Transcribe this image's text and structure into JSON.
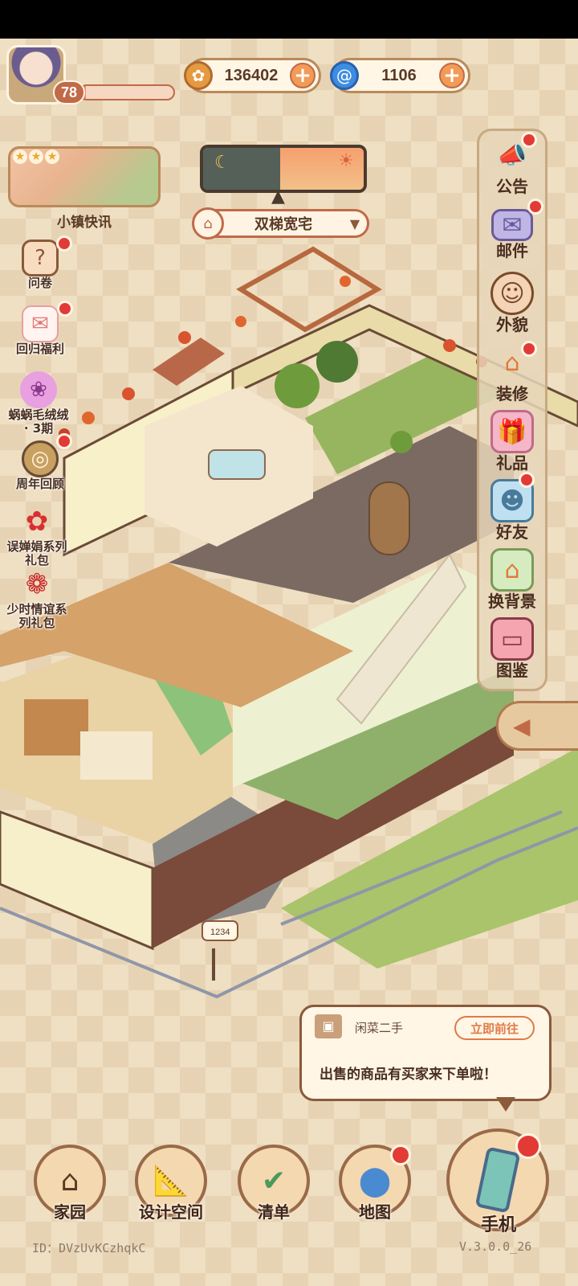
{
  "player": {
    "level": "78",
    "exp_fraction": 0.06
  },
  "currency": {
    "coins": "136402",
    "gems": "1106",
    "coin_icon": "coin-icon",
    "gem_icon": "swirl-gem-icon"
  },
  "news": {
    "label": "小镇快讯",
    "stars": 3
  },
  "house": {
    "name": "双梯宽宅"
  },
  "left_menu": [
    {
      "label": "问卷",
      "icon": "questionnaire-icon",
      "badge": true
    },
    {
      "label": "回归福利",
      "icon": "cat-letter-icon",
      "badge": true
    },
    {
      "label": "蜗蜗毛绒绒\n· 3期",
      "icon": "plush-icon",
      "badge": false
    },
    {
      "label": "周年回顾",
      "icon": "film-reel-icon",
      "badge": true
    },
    {
      "label": "误婵娟系列\n礼包",
      "icon": "flower-gift-icon",
      "badge": false
    },
    {
      "label": "少时情谊系\n列礼包",
      "icon": "rose-gift-icon",
      "badge": false
    }
  ],
  "right_menu": [
    {
      "label": "公告",
      "icon": "megaphone-icon",
      "badge": true
    },
    {
      "label": "邮件",
      "icon": "envelope-icon",
      "badge": true
    },
    {
      "label": "外貌",
      "icon": "face-icon",
      "badge": false
    },
    {
      "label": "装修",
      "icon": "house-wrench-icon",
      "badge": true
    },
    {
      "label": "礼品",
      "icon": "gift-icon",
      "badge": false
    },
    {
      "label": "好友",
      "icon": "friend-book-icon",
      "badge": true
    },
    {
      "label": "换背景",
      "icon": "landscape-icon",
      "badge": false
    },
    {
      "label": "图鉴",
      "icon": "album-icon",
      "badge": false
    }
  ],
  "notice": {
    "title": "闲菜二手",
    "action": "立即前往",
    "message": "出售的商品有买家来下单啦！"
  },
  "nav": [
    {
      "label": "家园",
      "icon": "home-icon",
      "badge": false
    },
    {
      "label": "设计空间",
      "icon": "ruler-icon",
      "badge": false
    },
    {
      "label": "清单",
      "icon": "checklist-icon",
      "badge": false
    },
    {
      "label": "地图",
      "icon": "map-pin-icon",
      "badge": true
    }
  ],
  "phone": {
    "label": "手机",
    "badge": true
  },
  "mailbox": {
    "number": "1234"
  },
  "footer": {
    "id": "ID：DVzUvKCzhqkC",
    "version": "V.3.0.0_26"
  },
  "colors": {
    "accent": "#c06a48",
    "badge": "#e23b36",
    "frame": "#9a6a48"
  }
}
